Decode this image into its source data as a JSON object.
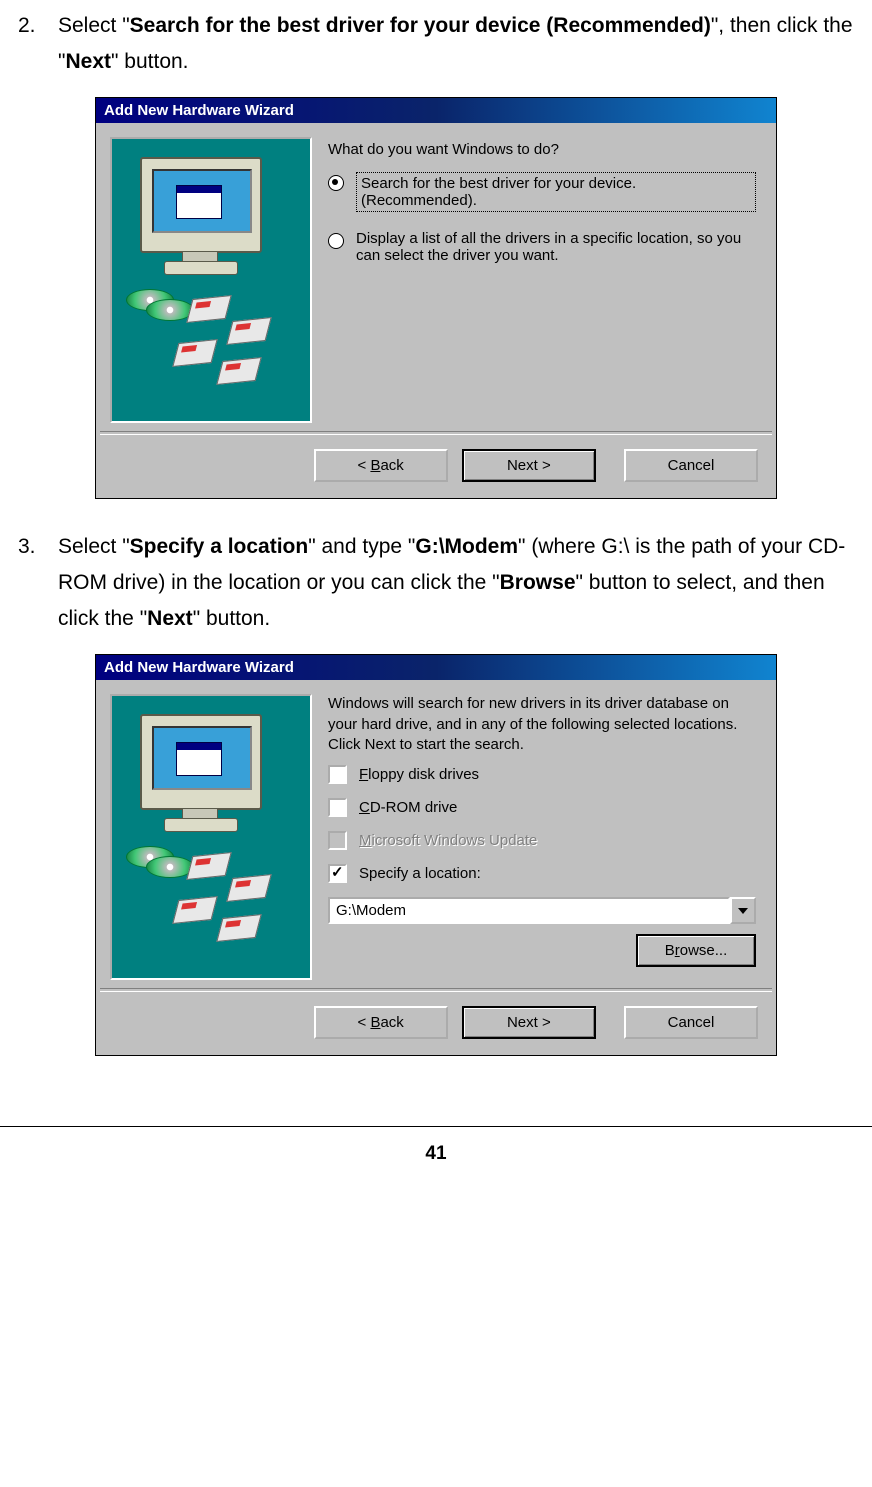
{
  "step2": {
    "num": "2.",
    "t1": "Select \"",
    "bold1": "Search for the best driver for your device (Recommended)",
    "t2": "\", then click the \"",
    "bold2": "Next",
    "t3": "\" button."
  },
  "step3": {
    "num": "3.",
    "t1": "Select \"",
    "bold1": "Specify a location",
    "t2": "\" and type \"",
    "bold2": "G:\\Modem",
    "t3": "\" (where G:\\ is the path of your CD-ROM drive) in the location or you can click the \"",
    "bold3": "Browse",
    "t4": "\" button to select, and then click the \"",
    "bold4": "Next",
    "t5": "\" button."
  },
  "dlg1": {
    "title": "Add New Hardware Wizard",
    "prompt": "What do you want Windows to do?",
    "opt1": "Search for the best driver for your device. (Recommended).",
    "opt2": "Display a list of all the drivers in a specific location, so you can select the driver you want.",
    "back_pre": "< ",
    "back_u": "B",
    "back_post": "ack",
    "next": "Next >",
    "cancel": "Cancel"
  },
  "dlg2": {
    "title": "Add New Hardware Wizard",
    "intro": "Windows will search for new drivers in its driver database on your hard drive, and in any of the following selected locations. Click Next to start the search.",
    "floppy_u": "F",
    "floppy_post": "loppy disk drives",
    "cdrom_u": "C",
    "cdrom_post": "D-ROM drive",
    "msupdate_u": "M",
    "msupdate_post": "icrosoft Windows Update",
    "specify": "Specify a location:",
    "path": "G:\\Modem",
    "browse_pre": "B",
    "browse_u": "r",
    "browse_post": "owse...",
    "back_pre": "< ",
    "back_u": "B",
    "back_post": "ack",
    "next": "Next >",
    "cancel": "Cancel"
  },
  "pagenum": "41"
}
